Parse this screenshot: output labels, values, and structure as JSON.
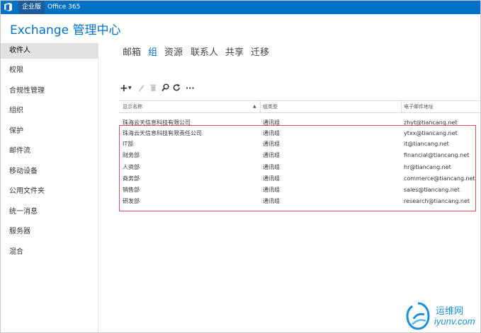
{
  "topbar": {
    "edition_label": "企业版",
    "o365_label": "Office 365"
  },
  "app_title": "Exchange 管理中心",
  "sidebar": {
    "items": [
      {
        "label": "收件人"
      },
      {
        "label": "权限"
      },
      {
        "label": "合规性管理"
      },
      {
        "label": "组织"
      },
      {
        "label": "保护"
      },
      {
        "label": "邮件流"
      },
      {
        "label": "移动设备"
      },
      {
        "label": "公用文件夹"
      },
      {
        "label": "统一消息"
      },
      {
        "label": "服务器"
      },
      {
        "label": "混合"
      }
    ],
    "active_index": 0
  },
  "tabs": [
    {
      "label": "邮箱"
    },
    {
      "label": "组"
    },
    {
      "label": "资源"
    },
    {
      "label": "联系人"
    },
    {
      "label": "共享"
    },
    {
      "label": "迁移"
    }
  ],
  "toolbar": {
    "icons": [
      "add-icon",
      "dropdown-caret-icon",
      "edit-icon",
      "delete-icon",
      "search-icon",
      "refresh-icon",
      "more-icon"
    ]
  },
  "grid": {
    "columns": [
      "显示名称",
      "组类型",
      "电子邮件地址"
    ],
    "rows": [
      {
        "name": "珠海云天信息科技有限公司",
        "type": "通讯组",
        "email": "zhyt@tiancang.net"
      },
      {
        "name": "珠海云天信息科技有限责任公司",
        "type": "通讯组",
        "email": "ytxx@tiancang.net"
      },
      {
        "name": "IT部",
        "type": "通讯组",
        "email": "it@tiancang.net"
      },
      {
        "name": "财务部",
        "type": "通讯组",
        "email": "financial@tiancang.net"
      },
      {
        "name": "人资部",
        "type": "通讯组",
        "email": "hr@tiancang.net"
      },
      {
        "name": "商务部",
        "type": "通讯组",
        "email": "commerce@tiancang.net"
      },
      {
        "name": "销售部",
        "type": "通讯组",
        "email": "sales@tiancang.net"
      },
      {
        "name": "研发部",
        "type": "通讯组",
        "email": "research@tiancang.net"
      }
    ]
  },
  "watermark": {
    "cn": "运维网",
    "en": "iyunv.com"
  },
  "colors": {
    "topbar": "#0072c6",
    "accent": "#0072c6",
    "highlight_border": "#d84e5a"
  }
}
